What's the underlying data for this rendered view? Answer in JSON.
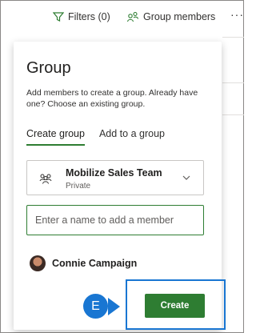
{
  "toolbar": {
    "filters_label": "Filters (0)",
    "group_members_label": "Group members",
    "more_label": "···"
  },
  "panel": {
    "title": "Group",
    "description": "Add members to create a group. Already have one? Choose an existing group.",
    "tabs": [
      {
        "label": "Create group",
        "active": true
      },
      {
        "label": "Add to a group",
        "active": false
      }
    ],
    "team": {
      "name": "Mobilize Sales Team",
      "visibility": "Private"
    },
    "member_input": {
      "value": "",
      "placeholder": "Enter a name to add a member"
    },
    "members": [
      {
        "name": "Connie Campaign"
      }
    ],
    "create_label": "Create"
  },
  "callout": {
    "label": "E"
  },
  "colors": {
    "accent_green": "#2e7d32",
    "callout_blue": "#1976d2"
  }
}
